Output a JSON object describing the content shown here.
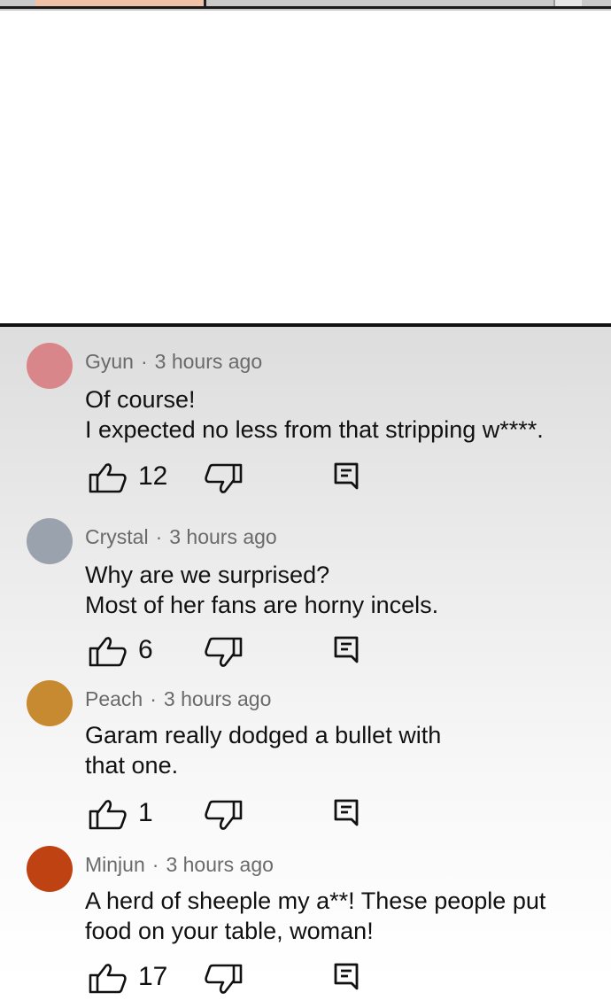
{
  "colors": {
    "avatar_gyun": "#d9868a",
    "avatar_crystal": "#9aa3ad",
    "avatar_peach": "#c88a30",
    "avatar_minjun": "#bf4213"
  },
  "comments": [
    {
      "author": "Gyun",
      "time": "3 hours ago",
      "lines": [
        "Of course!",
        "I expected no less from that stripping w****."
      ],
      "likes": "12"
    },
    {
      "author": "Crystal",
      "time": "3 hours ago",
      "lines": [
        "Why are we surprised?",
        "Most of her fans are horny incels."
      ],
      "likes": "6"
    },
    {
      "author": "Peach",
      "time": "3 hours ago",
      "lines": [
        "Garam really dodged a bullet with",
        "that one."
      ],
      "likes": "1"
    },
    {
      "author": "Minjun",
      "time": "3 hours ago",
      "lines": [
        "A herd of sheeple my a**! These people put",
        "food on your table, woman!"
      ],
      "likes": "17"
    }
  ],
  "separator": "·",
  "icons": [
    "thumbs-up-icon",
    "thumbs-down-icon",
    "reply-icon"
  ]
}
